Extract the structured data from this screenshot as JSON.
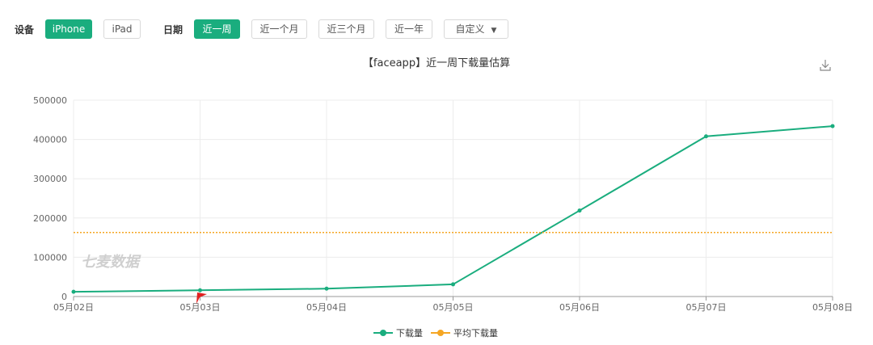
{
  "filters": {
    "device_label": "设备",
    "devices": [
      "iPhone",
      "iPad"
    ],
    "active_device": "iPhone",
    "date_label": "日期",
    "date_ranges": [
      "近一周",
      "近一个月",
      "近三个月",
      "近一年"
    ],
    "active_date_range": "近一周",
    "custom_label": "自定义"
  },
  "icons": {
    "download": "download-icon",
    "dropdown": "caret-down-icon",
    "marker": "red-flag-icon"
  },
  "watermark": "七麦数据",
  "colors": {
    "accent": "#1aad7e",
    "average": "#f5a623",
    "marker": "#e02020"
  },
  "chart_data": {
    "type": "line",
    "title": "【faceapp】近一周下载量估算",
    "categories": [
      "05月02日",
      "05月03日",
      "05月04日",
      "05月05日",
      "05月06日",
      "05月07日",
      "05月08日"
    ],
    "series": [
      {
        "name": "下载量",
        "values": [
          12000,
          16000,
          20000,
          31000,
          219000,
          408000,
          434000
        ],
        "color": "#1aad7e",
        "style": "solid"
      },
      {
        "name": "平均下载量",
        "values": [
          163000,
          163000,
          163000,
          163000,
          163000,
          163000,
          163000
        ],
        "color": "#f5a623",
        "style": "dotted"
      }
    ],
    "ylim": [
      0,
      500000
    ],
    "yticks": [
      "0",
      "100000",
      "200000",
      "300000",
      "400000",
      "500000"
    ],
    "grid": true,
    "legend": "bottom-center"
  }
}
